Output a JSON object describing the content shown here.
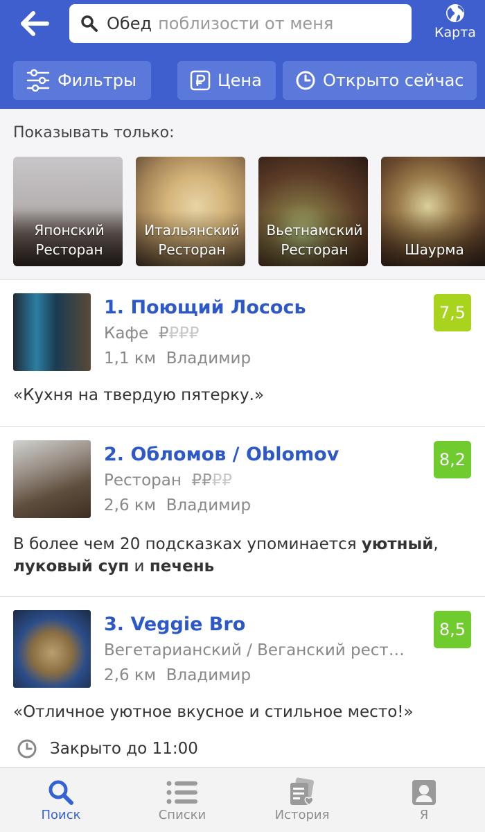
{
  "header": {
    "search_term": "Обед",
    "search_placeholder": "поблизости от меня",
    "map_label": "Карта",
    "filters": [
      {
        "label": "Фильтры",
        "icon": "sliders-icon"
      },
      {
        "label": "Цена",
        "icon": "ruble-icon"
      },
      {
        "label": "Открыто сейчас",
        "icon": "clock-icon"
      }
    ]
  },
  "only_show": {
    "title": "Показывать только:",
    "categories": [
      {
        "label": "Японский Ресторан"
      },
      {
        "label": "Итальянский Ресторан"
      },
      {
        "label": "Вьетнамский Ресторан"
      },
      {
        "label": "Шаурма"
      }
    ]
  },
  "results": [
    {
      "title": "1. Поющий Лосось",
      "category": "Кафе",
      "price_active": "₽",
      "price_inactive": "₽₽₽",
      "distance": "1,1 км",
      "city": "Владимир",
      "rating": "7,5",
      "rating_color": "#a8d41e",
      "snippet": "«Кухня на твердую пятерку.»"
    },
    {
      "title": "2. Обломов / Oblomov",
      "category": "Ресторан",
      "price_active": "₽₽",
      "price_inactive": "₽₽",
      "distance": "2,6 км",
      "city": "Владимир",
      "rating": "8,2",
      "rating_color": "#6fcb2e",
      "snippet_parts": {
        "p1": "В более чем 20 подсказках упоминается ",
        "b1": "уютный",
        "p2": ",",
        "b2": "луковый суп",
        "p3": " и ",
        "b3": "печень"
      }
    },
    {
      "title": "3. Veggie Bro",
      "category": "Вегетарианский / Веганский рест…",
      "distance": "2,6 км",
      "city": "Владимир",
      "rating": "8,5",
      "rating_color": "#6fcb2e",
      "snippet": "«Отличное уютное вкусное и стильное место!»",
      "hours": "Закрыто до 11:00"
    }
  ],
  "tabbar": [
    {
      "label": "Поиск",
      "icon": "search-icon",
      "active": true
    },
    {
      "label": "Списки",
      "icon": "list-icon",
      "active": false
    },
    {
      "label": "История",
      "icon": "history-icon",
      "active": false
    },
    {
      "label": "Я",
      "icon": "profile-icon",
      "active": false
    }
  ],
  "colors": {
    "header_bg": "#3f5fcf",
    "button_bg": "#5b78db",
    "title_blue": "#2d58c8",
    "active_tab": "#3561d6"
  }
}
